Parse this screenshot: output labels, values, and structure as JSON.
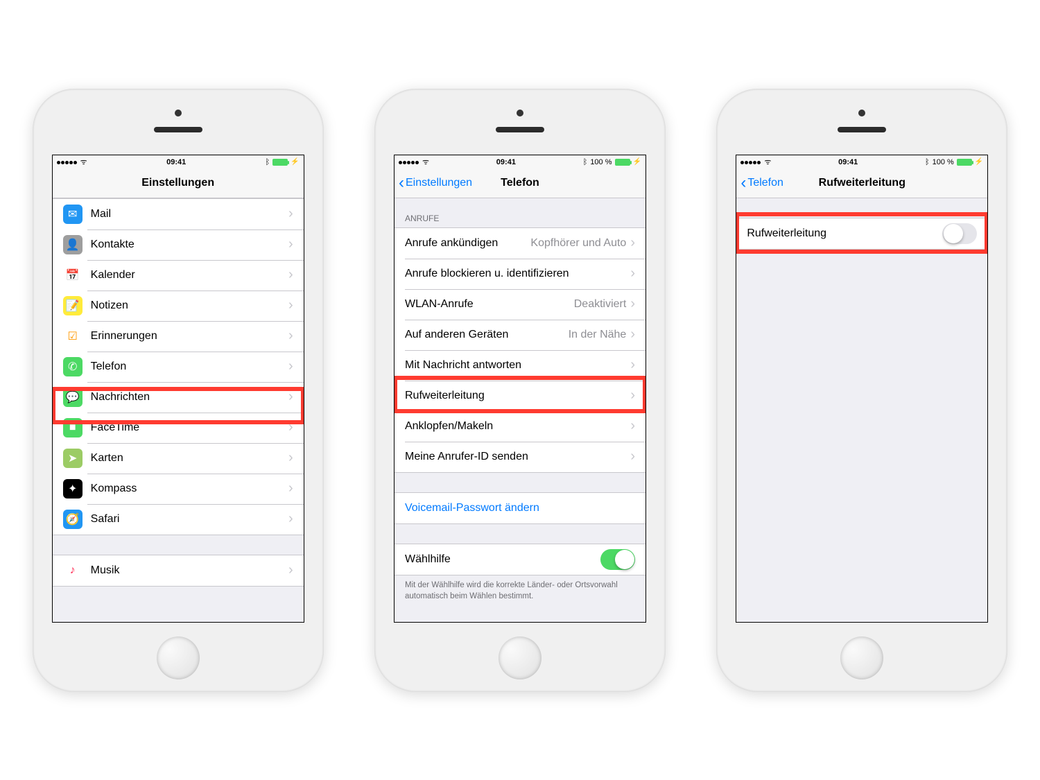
{
  "status": {
    "time": "09:41",
    "battery_text": "100 %"
  },
  "phone1": {
    "title": "Einstellungen",
    "items": [
      {
        "label": "Mail",
        "icon": "✉",
        "bg": "#2196f3"
      },
      {
        "label": "Kontakte",
        "icon": "👤",
        "bg": "#9e9e9e"
      },
      {
        "label": "Kalender",
        "icon": "📅",
        "bg": "#ffffff",
        "fg": "#ff3b30"
      },
      {
        "label": "Notizen",
        "icon": "📝",
        "bg": "#ffeb3b",
        "fg": "#8d6e63"
      },
      {
        "label": "Erinnerungen",
        "icon": "☑",
        "bg": "#ffffff",
        "fg": "#ff9800"
      },
      {
        "label": "Telefon",
        "icon": "✆",
        "bg": "#4cd964"
      },
      {
        "label": "Nachrichten",
        "icon": "💬",
        "bg": "#4cd964"
      },
      {
        "label": "FaceTime",
        "icon": "■",
        "bg": "#4cd964"
      },
      {
        "label": "Karten",
        "icon": "➤",
        "bg": "#9ccc65"
      },
      {
        "label": "Kompass",
        "icon": "✦",
        "bg": "#000000"
      },
      {
        "label": "Safari",
        "icon": "🧭",
        "bg": "#2196f3"
      }
    ],
    "group2": [
      {
        "label": "Musik",
        "icon": "♪",
        "bg": "#ffffff",
        "fg": "#ff2d55"
      }
    ]
  },
  "phone2": {
    "back": "Einstellungen",
    "title": "Telefon",
    "section_calls": "ANRUFE",
    "rows": [
      {
        "label": "Anrufe ankündigen",
        "detail": "Kopfhörer und Auto"
      },
      {
        "label": "Anrufe blockieren u. identifizieren"
      },
      {
        "label": "WLAN-Anrufe",
        "detail": "Deaktiviert"
      },
      {
        "label": "Auf anderen Geräten",
        "detail": "In der Nähe"
      },
      {
        "label": "Mit Nachricht antworten"
      },
      {
        "label": "Rufweiterleitung"
      },
      {
        "label": "Anklopfen/Makeln"
      },
      {
        "label": "Meine Anrufer-ID senden"
      }
    ],
    "voicemail": "Voicemail-Passwort ändern",
    "dialassist": {
      "label": "Wählhilfe",
      "on": true
    },
    "dialassist_footer": "Mit der Wählhilfe wird die korrekte Länder- oder Ortsvorwahl automatisch beim Wählen bestimmt."
  },
  "phone3": {
    "back": "Telefon",
    "title": "Rufweiterleitung",
    "toggle": {
      "label": "Rufweiterleitung",
      "on": false
    }
  }
}
